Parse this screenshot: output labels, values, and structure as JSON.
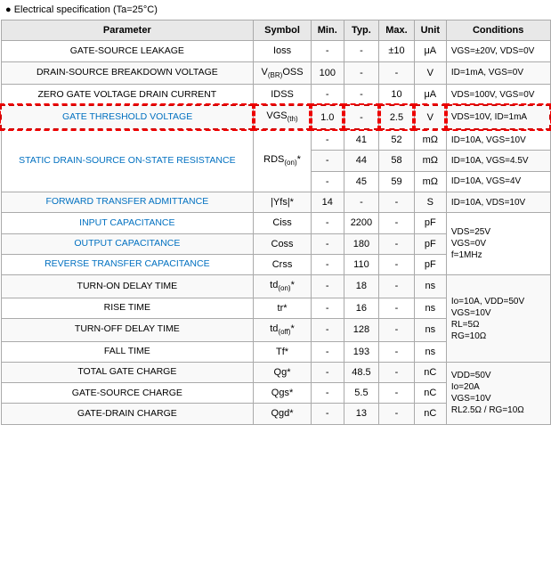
{
  "header": {
    "text": "● Electrical specification (Ta=25°C)"
  },
  "columns": [
    "Parameter",
    "Symbol",
    "Min.",
    "Typ.",
    "Max.",
    "Unit",
    "Conditions"
  ],
  "rows": [
    {
      "id": "gate-source-leakage",
      "param": "GATE-SOURCE LEAKAGE",
      "symbol": "Ioss",
      "min": "-",
      "typ": "-",
      "max": "±10",
      "unit": "μA",
      "conditions": "VGS=±20V, VDS=0V",
      "highlight": false,
      "blue": false,
      "rowspan": 1
    },
    {
      "id": "drain-source-breakdown",
      "param": "DRAIN-SOURCE BREAKDOWN VOLTAGE",
      "symbol": "V(BR)OSS",
      "min": "100",
      "typ": "-",
      "max": "-",
      "unit": "V",
      "conditions": "ID=1mA, VGS=0V",
      "highlight": false,
      "blue": false,
      "rowspan": 1
    },
    {
      "id": "zero-gate-voltage",
      "param": "ZERO GATE VOLTAGE DRAIN CURRENT",
      "symbol": "IDSS",
      "min": "-",
      "typ": "-",
      "max": "10",
      "unit": "μA",
      "conditions": "VDS=100V, VGS=0V",
      "highlight": false,
      "blue": false,
      "rowspan": 1
    },
    {
      "id": "gate-threshold",
      "param": "GATE THRESHOLD VOLTAGE",
      "symbol": "VGS(th)",
      "min": "1.0",
      "typ": "-",
      "max": "2.5",
      "unit": "V",
      "conditions": "VDS=10V, ID=1mA",
      "highlight": true,
      "blue": true,
      "rowspan": 1
    },
    {
      "id": "static-drain-1",
      "param": "STATIC DRAIN-SOURCE ON-STATE RESISTANCE",
      "symbol": "RDS(on)*",
      "min": "-",
      "typ": "41",
      "max": "52",
      "unit": "mΩ",
      "conditions": "ID=10A, VGS=10V",
      "highlight": false,
      "blue": false,
      "rowspan": 3,
      "rowIndex": 0
    },
    {
      "id": "static-drain-2",
      "param": "",
      "symbol": "",
      "min": "-",
      "typ": "44",
      "max": "58",
      "unit": "mΩ",
      "conditions": "ID=10A, VGS=4.5V",
      "highlight": false,
      "blue": false,
      "rowspan": 0,
      "rowIndex": 1
    },
    {
      "id": "static-drain-3",
      "param": "",
      "symbol": "",
      "min": "-",
      "typ": "45",
      "max": "59",
      "unit": "mΩ",
      "conditions": "ID=10A, VGS=4V",
      "highlight": false,
      "blue": false,
      "rowspan": 0,
      "rowIndex": 2
    },
    {
      "id": "forward-transfer",
      "param": "FORWARD TRANSFER ADMITTANCE",
      "symbol": "|Yfs|*",
      "min": "14",
      "typ": "-",
      "max": "-",
      "unit": "S",
      "conditions": "ID=10A, VDS=10V",
      "highlight": false,
      "blue": true,
      "rowspan": 1
    },
    {
      "id": "input-capacitance",
      "param": "INPUT CAPACITANCE",
      "symbol": "Ciss",
      "min": "-",
      "typ": "2200",
      "max": "-",
      "unit": "pF",
      "conditions": "",
      "highlight": false,
      "blue": true,
      "rowspan": 3,
      "condRowspan": true
    },
    {
      "id": "output-capacitance",
      "param": "OUTPUT CAPACITANCE",
      "symbol": "Coss",
      "min": "-",
      "typ": "180",
      "max": "-",
      "unit": "pF",
      "conditions": "",
      "highlight": false,
      "blue": true,
      "rowspan": 0,
      "condRowspan": true
    },
    {
      "id": "reverse-transfer",
      "param": "REVERSE TRANSFER CAPACITANCE",
      "symbol": "Crss",
      "min": "-",
      "typ": "110",
      "max": "-",
      "unit": "pF",
      "conditions": "",
      "highlight": false,
      "blue": true,
      "rowspan": 0,
      "condRowspan": true
    },
    {
      "id": "turn-on-delay",
      "param": "TURN-ON DELAY TIME",
      "symbol": "td(on)*",
      "min": "-",
      "typ": "18",
      "max": "-",
      "unit": "ns",
      "conditions": "",
      "highlight": false,
      "blue": false,
      "rowspan": 4,
      "condRowspan": true
    },
    {
      "id": "rise-time",
      "param": "RISE TIME",
      "symbol": "tr*",
      "min": "-",
      "typ": "16",
      "max": "-",
      "unit": "ns",
      "conditions": "",
      "highlight": false,
      "blue": false,
      "rowspan": 0,
      "condRowspan": true
    },
    {
      "id": "turn-off-delay",
      "param": "TURN-OFF DELAY TIME",
      "symbol": "td(off)*",
      "min": "-",
      "typ": "128",
      "max": "-",
      "unit": "ns",
      "conditions": "",
      "highlight": false,
      "blue": false,
      "rowspan": 0,
      "condRowspan": true
    },
    {
      "id": "fall-time",
      "param": "FALL TIME",
      "symbol": "Tf*",
      "min": "-",
      "typ": "193",
      "max": "-",
      "unit": "ns",
      "conditions": "",
      "highlight": false,
      "blue": false,
      "rowspan": 0,
      "condRowspan": true
    },
    {
      "id": "total-gate-charge",
      "param": "TOTAL GATE CHARGE",
      "symbol": "Qg*",
      "min": "-",
      "typ": "48.5",
      "max": "-",
      "unit": "nC",
      "conditions": "",
      "highlight": false,
      "blue": false,
      "rowspan": 3,
      "condRowspan": true
    },
    {
      "id": "gate-source-charge",
      "param": "GATE-SOURCE CHARGE",
      "symbol": "Qgs*",
      "min": "-",
      "typ": "5.5",
      "max": "-",
      "unit": "nC",
      "conditions": "",
      "highlight": false,
      "blue": false,
      "rowspan": 0,
      "condRowspan": true
    },
    {
      "id": "gate-drain-charge",
      "param": "GATE-DRAIN CHARGE",
      "symbol": "Qgd*",
      "min": "-",
      "typ": "13",
      "max": "-",
      "unit": "nC",
      "conditions": "",
      "highlight": false,
      "blue": false,
      "rowspan": 0,
      "condRowspan": true
    }
  ],
  "condition_groups": {
    "capacitance": "VDS=25V\nVGS=0V\nf=1MHz",
    "switching": "Io=10A, VDD=50V\nVGS=10V\nRL=5Ω\nRG=10Ω",
    "charge": "VDD=50V\nIo=20A\nVGS=10V\nRL2.5Ω / RG=10Ω"
  }
}
